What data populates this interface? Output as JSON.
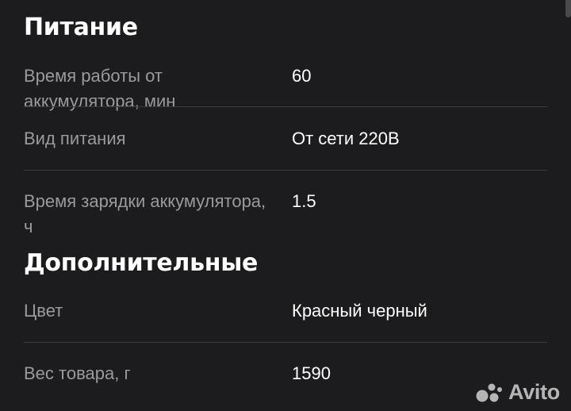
{
  "sections": [
    {
      "title": "Питание",
      "rows": [
        {
          "label": "Время работы от аккумулятора, мин",
          "value": "60"
        },
        {
          "label": "Вид питания",
          "value": "От сети 220В"
        },
        {
          "label": "Время зарядки аккумулятора, ч",
          "value": "1.5"
        }
      ]
    },
    {
      "title": "Дополнительные",
      "rows": [
        {
          "label": "Цвет",
          "value": "Красный черный"
        },
        {
          "label": "Вес товара, г",
          "value": "1590"
        }
      ]
    }
  ],
  "watermark": {
    "brand": "Avito",
    "icon": "avito-logo-icon"
  },
  "colors": {
    "background": "#1c1c1e",
    "label": "#9a9a9e",
    "value": "#ffffff",
    "divider": "#3a3a3d"
  }
}
